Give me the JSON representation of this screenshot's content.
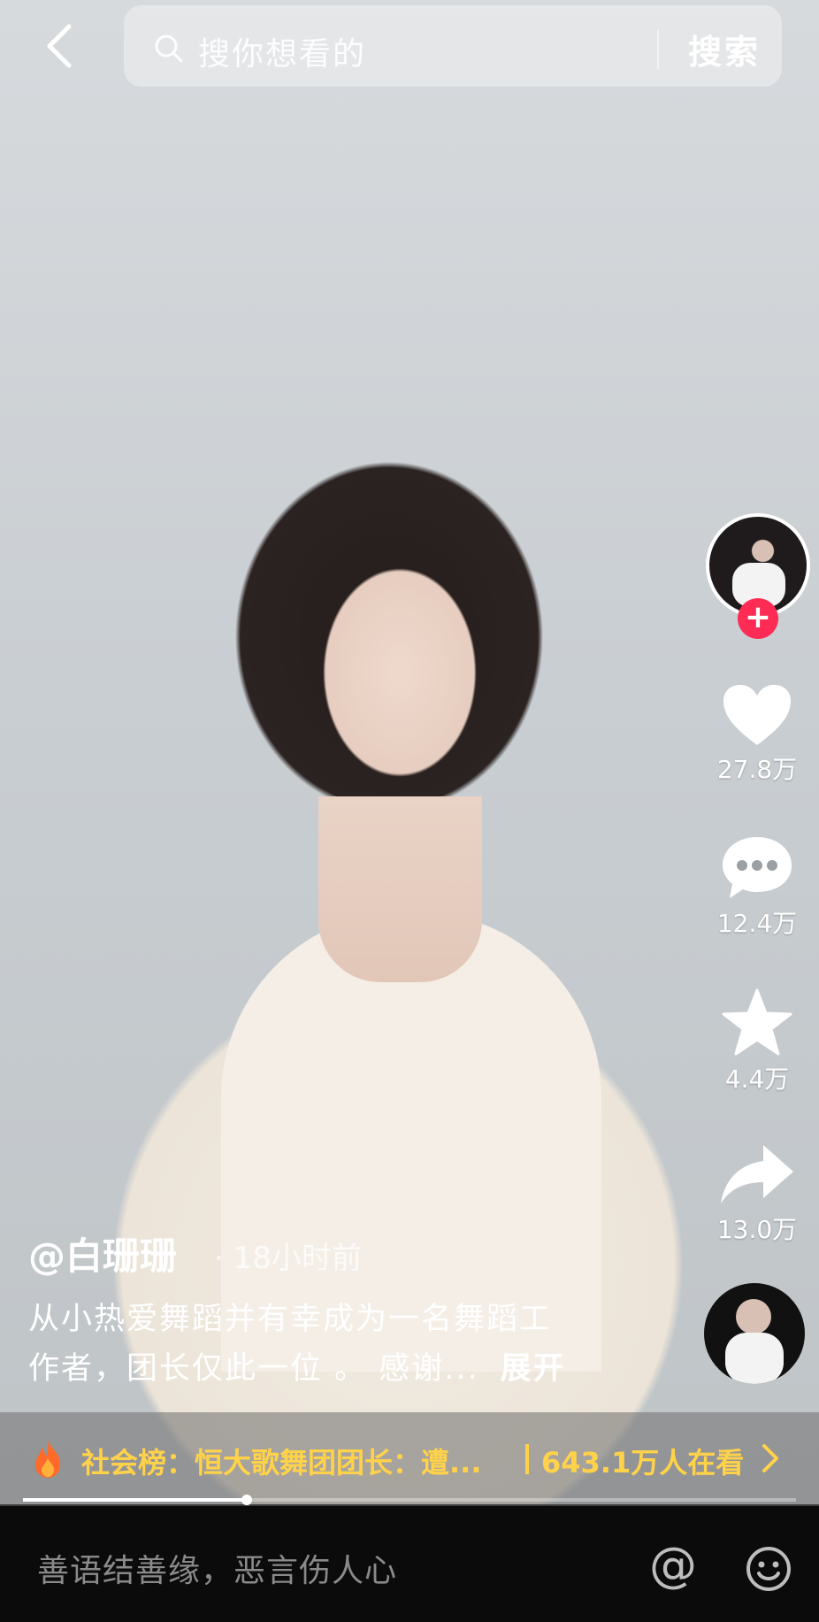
{
  "search": {
    "placeholder": "搜你想看的",
    "button_label": "搜索"
  },
  "actions": {
    "like_count": "27.8万",
    "comment_count": "12.4万",
    "favorite_count": "4.4万",
    "share_count": "13.0万",
    "follow_badge": "+"
  },
  "post": {
    "author": "@白珊珊",
    "time": "· 18小时前",
    "desc_line1": "从小热爱舞蹈并有幸成为一名舞蹈工",
    "desc_line2": "作者，团长仅此一位 。 感谢...",
    "expand_label": "展开"
  },
  "hot": {
    "text": "社会榜：恒大歌舞团团长：遭...",
    "viewers": "643.1万人在看"
  },
  "playback": {
    "progress": 0.29
  },
  "comment": {
    "placeholder": "善语结善缘，恶言伤人心",
    "at_label": "@"
  },
  "colors": {
    "accent_red": "#fe2c55",
    "hot_yellow": "#ffd24a"
  }
}
